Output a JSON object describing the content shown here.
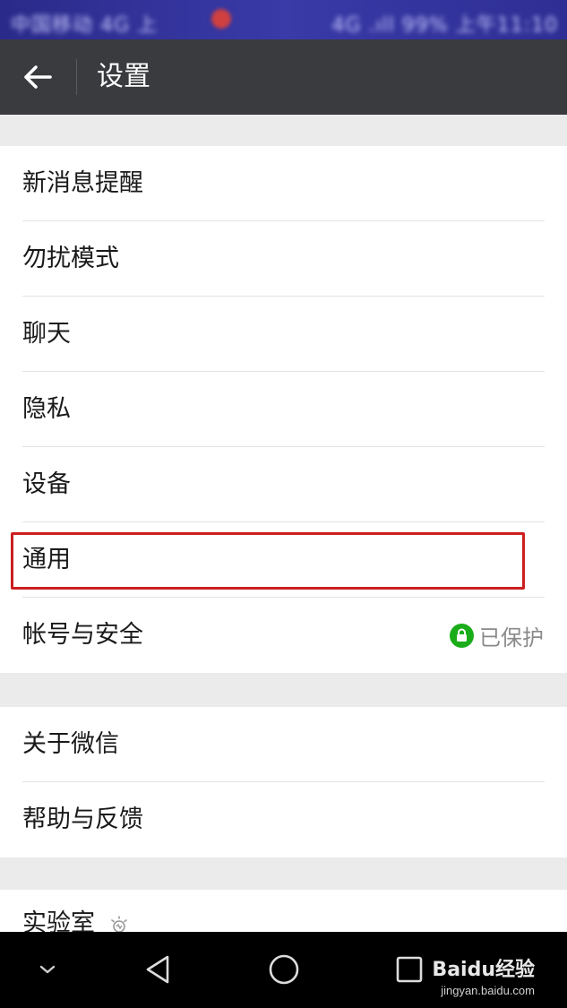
{
  "status_bar": {
    "left_text": "中国移动 4G 上",
    "right_text": "4G .ıll 99% 上午11:10"
  },
  "header": {
    "title": "设置",
    "back_icon": "arrow-left-icon"
  },
  "groups": [
    {
      "items": [
        {
          "label": "新消息提醒"
        },
        {
          "label": "勿扰模式"
        },
        {
          "label": "聊天"
        },
        {
          "label": "隐私"
        },
        {
          "label": "设备"
        },
        {
          "label": "通用",
          "highlighted": true
        },
        {
          "label": "帐号与安全",
          "badge": "已保护",
          "badge_icon": "lock-icon"
        }
      ]
    },
    {
      "items": [
        {
          "label": "关于微信"
        },
        {
          "label": "帮助与反馈"
        }
      ]
    },
    {
      "items": [
        {
          "label": "实验室",
          "icon": "lab-bulb-icon"
        }
      ]
    }
  ],
  "nav_bar": {
    "buttons": [
      "chevron-down-icon",
      "back-triangle-icon",
      "home-circle-icon",
      "recents-square-icon"
    ]
  },
  "watermark": {
    "logo": "Baidu经验",
    "url": "jingyan.baidu.com"
  },
  "colors": {
    "app_bar": "#3a3b3f",
    "highlight": "#cc1f1f",
    "lock_badge": "#1aad19"
  }
}
